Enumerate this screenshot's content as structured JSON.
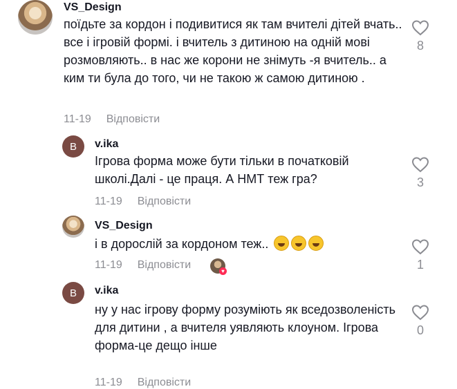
{
  "comments": [
    {
      "username": "VS_Design",
      "text": "поїдьте за кордон і подивитися як там вчителі дітей вчать.. все і ігровій формі. і вчитель з дитиною на одній мові розмовляють.. в нас же корони не знімуть -я вчитель.. а ким ти була до того, чи не такою ж самою дитиною .",
      "date": "11-19",
      "reply_label": "Відповісти",
      "likes": "8",
      "avatar_icon": "user-photo"
    },
    {
      "username": "v.ika",
      "avatar_letter": "B",
      "text": "Ігрова форма може бути тільки в початковій школі.Далі - це праця. А НМТ теж гра?",
      "date": "11-19",
      "reply_label": "Відповісти",
      "likes": "3"
    },
    {
      "username": "VS_Design",
      "text": "і в дорослій за кордоном теж..",
      "emojis": [
        "laughing-emoji",
        "laughing-emoji",
        "laughing-emoji"
      ],
      "date": "11-19",
      "reply_label": "Відповісти",
      "likes": "1",
      "creator_liked": true
    },
    {
      "username": "v.ika",
      "avatar_letter": "B",
      "text": "ну у нас ігрову форму розуміють як вседозволеність для дитини , а вчителя уявляють клоуном. Ігрова форма-це дещо інше",
      "date": "11-19",
      "reply_label": "Відповісти",
      "likes": "0"
    }
  ],
  "colors": {
    "text": "#161823",
    "muted": "rgba(22,24,35,0.5)",
    "letter_avatar": "#7a4a43",
    "heart": "#fe2c55"
  }
}
